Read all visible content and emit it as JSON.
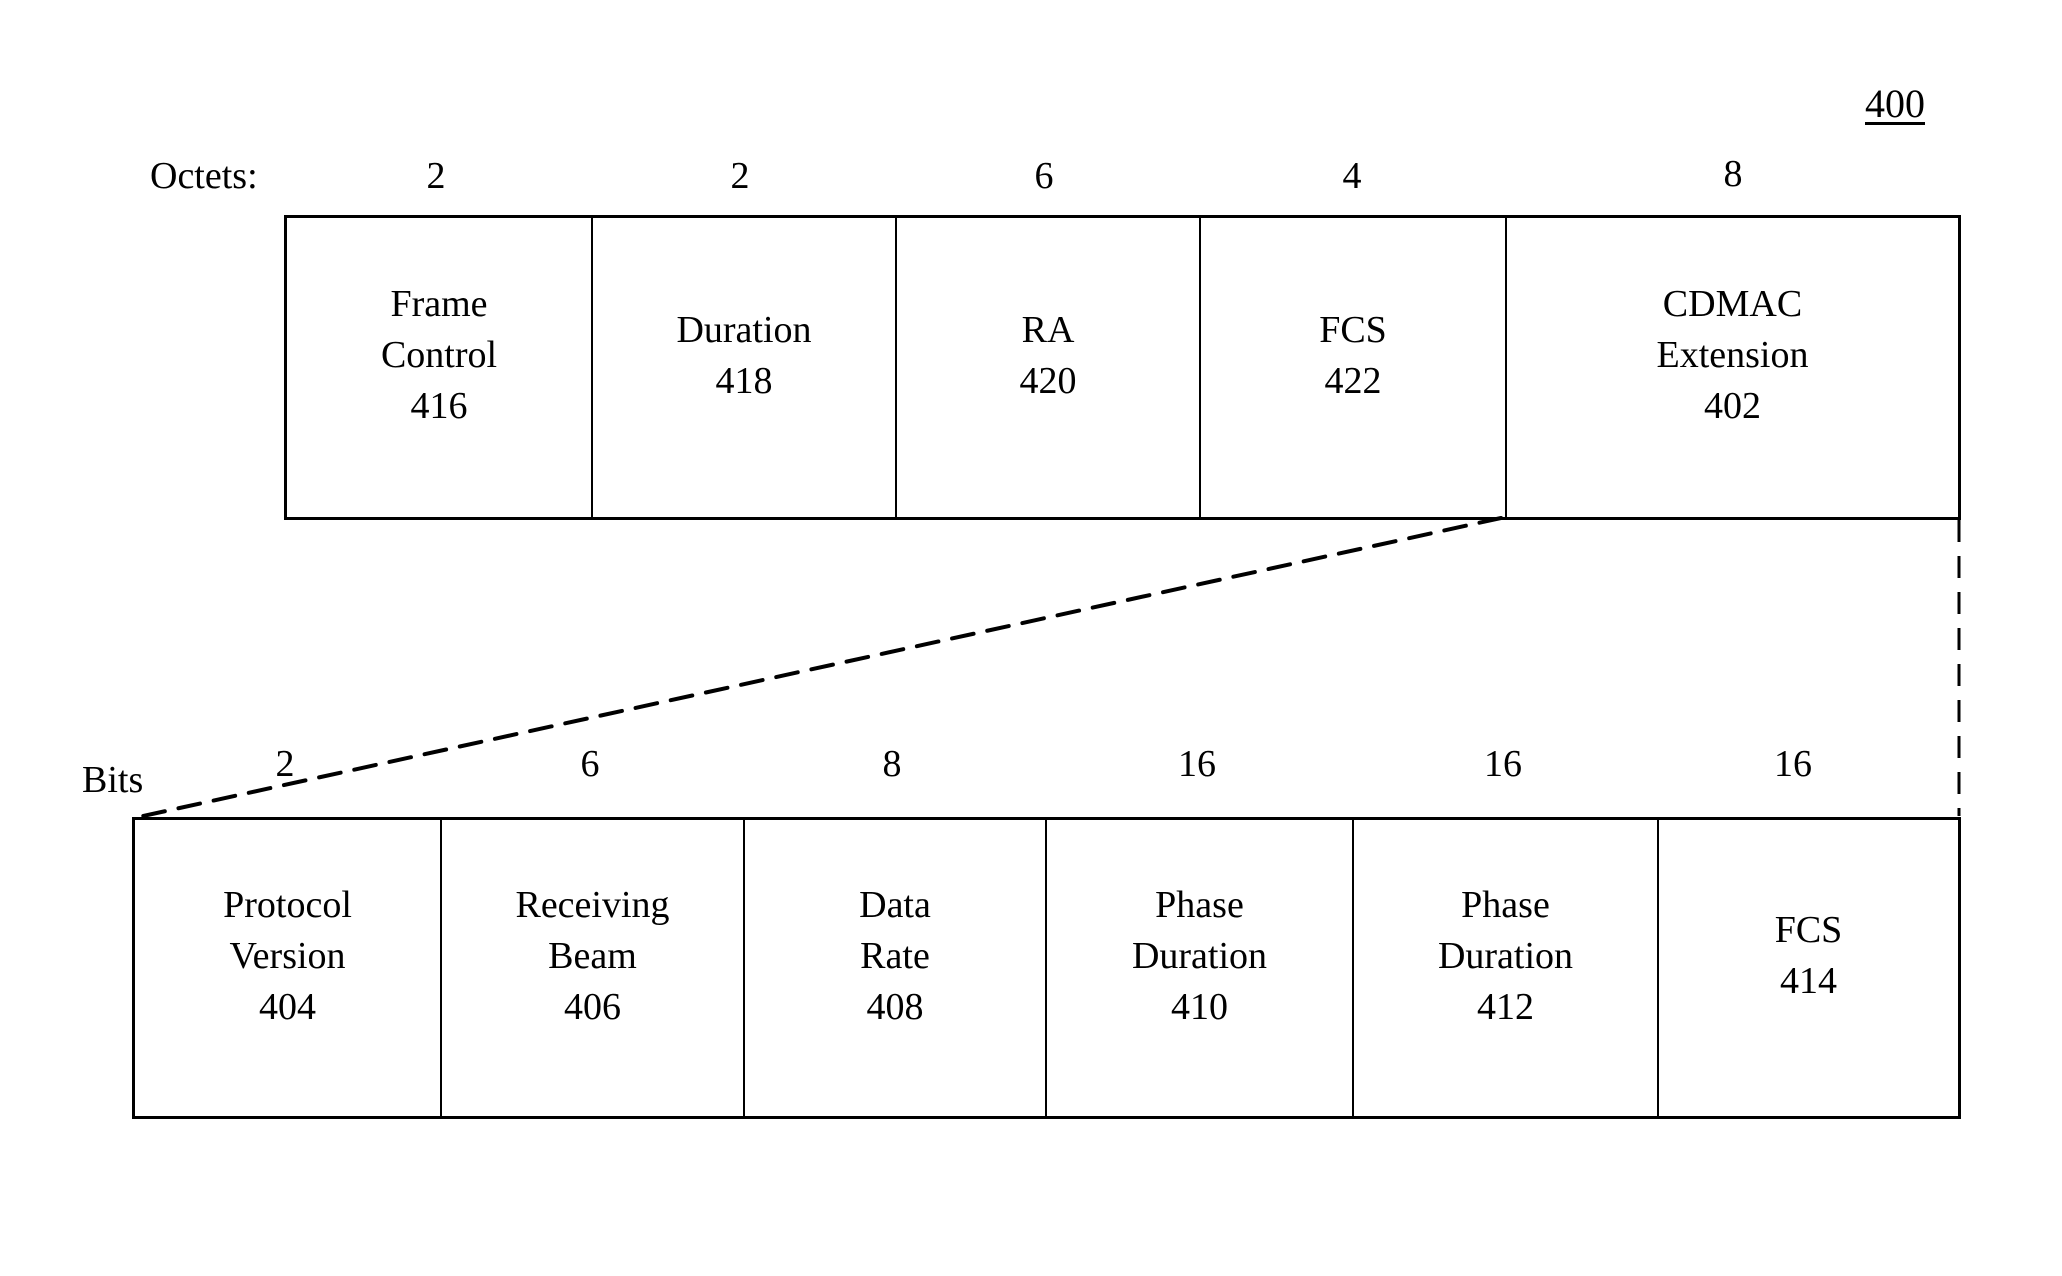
{
  "figure": {
    "reference_number": "400"
  },
  "mac_frame": {
    "size_unit_label": "Octets:",
    "fields": [
      {
        "name": "Frame Control",
        "lines": [
          "Frame",
          "Control"
        ],
        "ref": "416",
        "size": "2"
      },
      {
        "name": "Duration",
        "lines": [
          "Duration"
        ],
        "ref": "418",
        "size": "2"
      },
      {
        "name": "RA",
        "lines": [
          "RA"
        ],
        "ref": "420",
        "size": "6"
      },
      {
        "name": "FCS",
        "lines": [
          "FCS"
        ],
        "ref": "422",
        "size": "4"
      },
      {
        "name": "CDMAC Extension",
        "lines": [
          "CDMAC",
          "Extension"
        ],
        "ref": "402",
        "size": "8"
      }
    ]
  },
  "cdmac_extension": {
    "size_unit_label": "Bits",
    "expands_field": "CDMAC Extension",
    "fields": [
      {
        "name": "Protocol Version",
        "lines": [
          "Protocol",
          "Version"
        ],
        "ref": "404",
        "size": "2"
      },
      {
        "name": "Receiving Beam",
        "lines": [
          "Receiving",
          "Beam"
        ],
        "ref": "406",
        "size": "6"
      },
      {
        "name": "Data Rate",
        "lines": [
          "Data",
          "Rate"
        ],
        "ref": "408",
        "size": "8"
      },
      {
        "name": "Phase Duration",
        "lines": [
          "Phase",
          "Duration"
        ],
        "ref": "410",
        "size": "16"
      },
      {
        "name": "Phase Duration",
        "lines": [
          "Phase",
          "Duration"
        ],
        "ref": "412",
        "size": "16"
      },
      {
        "name": "FCS",
        "lines": [
          "FCS"
        ],
        "ref": "414",
        "size": "16"
      }
    ]
  }
}
